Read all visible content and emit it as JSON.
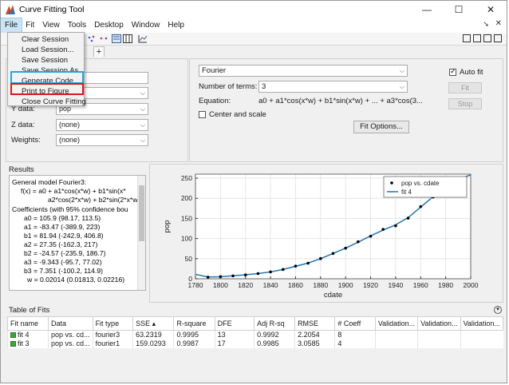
{
  "window": {
    "title": "Curve Fitting Tool",
    "controls": {
      "minimize": "—",
      "maximize": "☐",
      "close": "✕"
    }
  },
  "menubar": {
    "items": [
      "File",
      "Fit",
      "View",
      "Tools",
      "Desktop",
      "Window",
      "Help"
    ],
    "active": "File",
    "undock_arrow": "➘",
    "close_x": "✕"
  },
  "file_menu": {
    "items": [
      "Clear Session",
      "Load Session...",
      "Save Session",
      "Save Session As...",
      "Generate Code",
      "Print to Figure",
      "Close Curve Fitting"
    ],
    "highlight_colors": {
      "blue": "#1ea5e8",
      "red": "#e0161b"
    }
  },
  "tabs": {
    "add_label": "+"
  },
  "data_panel": {
    "fit_name_value": "",
    "y_label": "Y data:",
    "y_value": "pop",
    "z_label": "Z data:",
    "z_value": "(none)",
    "weights_label": "Weights:",
    "weights_value": "(none)"
  },
  "fit_panel": {
    "fit_type": "Fourier",
    "terms_label": "Number of terms:",
    "terms_value": "3",
    "equation_label": "Equation:",
    "equation_value": "a0 + a1*cos(x*w) + b1*sin(x*w) + ... + a3*cos(3...",
    "center_scale_label": "Center and scale",
    "center_scale_checked": false,
    "fit_options_label": "Fit Options...",
    "autofit_label": "Auto fit",
    "autofit_checked": true,
    "fit_button": "Fit",
    "stop_button": "Stop"
  },
  "results": {
    "title": "Results",
    "lines": [
      "General model Fourier3:",
      "f(x) =  a0 + a1*cos(x*w) + b1*sin(x*",
      "a2*cos(2*x*w) + b2*sin(2*x*w",
      "Coefficients (with 95% confidence bou",
      "a0 =      105.9  (98.17, 113.5)",
      "a1 =     -83.47  (-389.9, 223)",
      "b1 =      81.94  (-242.9, 406.8)",
      "a2 =      27.35  (-162.3, 217)",
      "b2 =     -24.57  (-235.9, 186.7)",
      "a3 =     -9.343  (-95.7, 77.02)",
      "b3 =      7.351  (-100.2, 114.9)",
      "w =    0.02014  (0.01813, 0.02216)"
    ]
  },
  "chart_data": {
    "type": "scatter",
    "xlabel": "cdate",
    "ylabel": "pop",
    "xlim": [
      1780,
      2000
    ],
    "ylim": [
      0,
      260
    ],
    "xticks": [
      1780,
      1800,
      1820,
      1840,
      1860,
      1880,
      1900,
      1920,
      1940,
      1960,
      1980,
      2000
    ],
    "yticks": [
      0,
      50,
      100,
      150,
      200,
      250
    ],
    "legend_position": "top-right",
    "legend": [
      "pop vs. cdate",
      "fit 4"
    ],
    "series": [
      {
        "name": "pop vs. cdate",
        "style": "points",
        "x": [
          1790,
          1800,
          1810,
          1820,
          1830,
          1840,
          1850,
          1860,
          1870,
          1880,
          1890,
          1900,
          1910,
          1920,
          1930,
          1940,
          1950,
          1960,
          1970,
          1980,
          1990
        ],
        "y": [
          3.9,
          5.3,
          7.2,
          9.6,
          12.9,
          17.1,
          23.1,
          31.4,
          38.6,
          50.2,
          62.9,
          76.0,
          92.0,
          105.7,
          122.8,
          131.7,
          150.7,
          179.3,
          203.2,
          226.5,
          248.7
        ]
      },
      {
        "name": "fit 4",
        "style": "line",
        "x": [
          1780,
          1790,
          1800,
          1810,
          1820,
          1830,
          1840,
          1850,
          1860,
          1870,
          1880,
          1890,
          1900,
          1910,
          1920,
          1930,
          1940,
          1950,
          1960,
          1970,
          1980,
          1990,
          2000
        ],
        "y": [
          11.0,
          4.5,
          5.0,
          7.5,
          10.0,
          13.0,
          17.0,
          23.0,
          31.0,
          39.0,
          50.0,
          63.0,
          76.0,
          91.0,
          106.5,
          121.0,
          134.0,
          152.0,
          178.0,
          204.0,
          226.0,
          247.0,
          258.0
        ]
      }
    ],
    "colors": {
      "points": "#000000",
      "line": "#1f77b4"
    }
  },
  "table": {
    "title": "Table of Fits",
    "collapse_icon": "▾",
    "headers": [
      "Fit name",
      "Data",
      "Fit type",
      "SSE ▴",
      "R-square",
      "DFE",
      "Adj R-sq",
      "RMSE",
      "# Coeff",
      "Validation...",
      "Validation...",
      "Validation..."
    ],
    "rows": [
      [
        "fit 4",
        "pop vs. cd...",
        "fourier3",
        "63.2319",
        "0.9995",
        "13",
        "0.9992",
        "2.2054",
        "8",
        "",
        "",
        ""
      ],
      [
        "fit 3",
        "pop vs. cd...",
        "fourier1",
        "159.0293",
        "0.9987",
        "17",
        "0.9985",
        "3.0585",
        "4",
        "",
        "",
        ""
      ]
    ]
  }
}
